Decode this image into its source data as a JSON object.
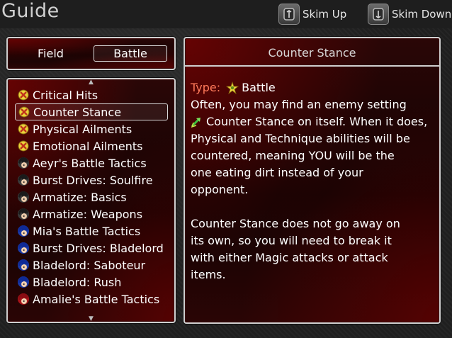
{
  "header": {
    "title": "Guide",
    "skim_up_label": "Skim Up",
    "skim_down_label": "Skim Down",
    "skim_up_key_icon": "controller-shoulder-button-icon",
    "skim_down_key_icon": "controller-shoulder-button-icon"
  },
  "filter": {
    "field_label": "Field",
    "battle_label": "Battle",
    "selected": "Battle"
  },
  "topics": [
    {
      "label": "Critical Hits",
      "icon": "battle-cross-icon"
    },
    {
      "label": "Counter Stance",
      "icon": "battle-cross-icon",
      "selected": true
    },
    {
      "label": "Physical Ailments",
      "icon": "battle-cross-icon"
    },
    {
      "label": "Emotional Ailments",
      "icon": "battle-cross-icon"
    },
    {
      "label": "Aeyr's Battle Tactics",
      "icon": "dark-haired-character-icon"
    },
    {
      "label": "Burst Drives: Soulfire",
      "icon": "dark-haired-character-icon"
    },
    {
      "label": "Armatize: Basics",
      "icon": "dark-haired-character-icon"
    },
    {
      "label": "Armatize: Weapons",
      "icon": "dark-haired-character-icon"
    },
    {
      "label": "Mia's Battle Tactics",
      "icon": "blue-haired-character-icon"
    },
    {
      "label": "Burst Drives: Bladelord",
      "icon": "blue-haired-character-icon"
    },
    {
      "label": "Bladelord: Saboteur",
      "icon": "blue-haired-character-icon"
    },
    {
      "label": "Bladelord: Rush",
      "icon": "blue-haired-character-icon"
    },
    {
      "label": "Amalie's Battle Tactics",
      "icon": "red-haired-character-icon"
    }
  ],
  "detail": {
    "title": "Counter Stance",
    "type_label": "Type:",
    "type_value": "Battle",
    "type_icon": "battle-star-icon",
    "counter_icon": "counter-stance-arrow-icon",
    "lines": [
      "Often, you may find an enemy setting",
      "Counter Stance on itself. When it does,",
      "Physical and Technique abilities will be",
      "countered, meaning YOU will be the",
      "one eating dirt instead of your",
      "opponent.",
      "",
      "Counter Stance does not go away on",
      "its own, so you will need to break it",
      "with either Magic attacks or attack",
      "items."
    ]
  },
  "colors": {
    "type_label": "#ff7a5a",
    "window_red": "#2a0606",
    "border": "#cfcfcf"
  }
}
